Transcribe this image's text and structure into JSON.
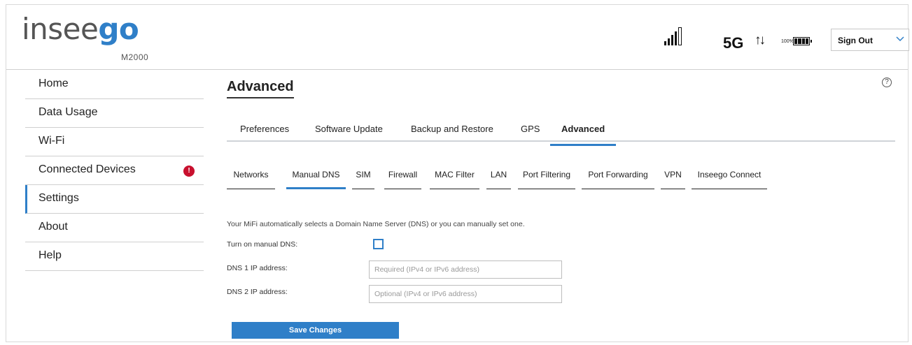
{
  "header": {
    "brand_prefix": "insee",
    "brand_suffix": "go",
    "model": "M2000",
    "network": "5G",
    "data_arrows": "↑↓",
    "battery_percent": "100%",
    "sign_out_label": "Sign Out",
    "signal_icon": "signal-bars-icon",
    "battery_icon": "battery-full-icon"
  },
  "sidebar": {
    "items": [
      {
        "label": "Home"
      },
      {
        "label": "Data Usage"
      },
      {
        "label": "Wi-Fi"
      },
      {
        "label": "Connected Devices",
        "badge": "!"
      },
      {
        "label": "Settings",
        "active": true
      },
      {
        "label": "About"
      },
      {
        "label": "Help"
      }
    ]
  },
  "main": {
    "title": "Advanced",
    "help_symbol": "?",
    "tabs": [
      {
        "label": "Preferences"
      },
      {
        "label": "Software Update"
      },
      {
        "label": "Backup and Restore"
      },
      {
        "label": "GPS"
      },
      {
        "label": "Advanced",
        "active": true
      }
    ],
    "subtabs": [
      {
        "label": "Networks"
      },
      {
        "label": "Manual DNS",
        "active": true
      },
      {
        "label": "SIM"
      },
      {
        "label": "Firewall"
      },
      {
        "label": "MAC Filter"
      },
      {
        "label": "LAN"
      },
      {
        "label": "Port Filtering"
      },
      {
        "label": "Port Forwarding"
      },
      {
        "label": "VPN"
      },
      {
        "label": "Inseego Connect"
      }
    ],
    "description": "Your MiFi automatically selects a Domain Name Server (DNS) or you can manually set one.",
    "manual_dns_label": "Turn on manual DNS:",
    "manual_dns_checked": false,
    "dns1_label": "DNS 1 IP address:",
    "dns1_placeholder": "Required (IPv4 or IPv6 address)",
    "dns1_value": "",
    "dns2_label": "DNS 2 IP address:",
    "dns2_placeholder": "Optional (IPv4 or IPv6 address)",
    "dns2_value": "",
    "save_label": "Save Changes"
  },
  "colors": {
    "accent": "#2f7fc8",
    "badge": "#c8102e"
  }
}
